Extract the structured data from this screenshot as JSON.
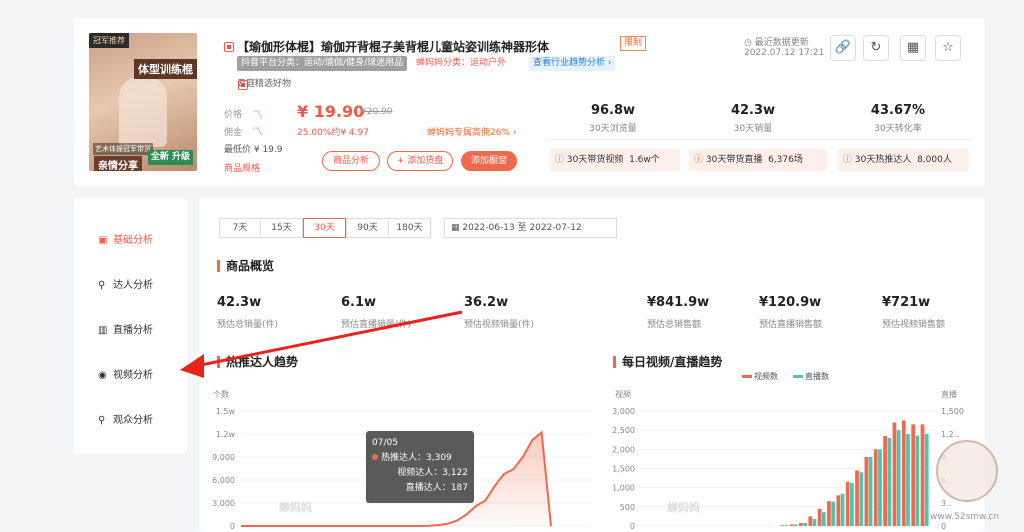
{
  "product": {
    "image": {
      "badge": "冠军推荐",
      "title": "体型训练棍",
      "sub1": "艺术体操冠军带货",
      "sub2": "亲情分享",
      "sub3": "全新 升级"
    },
    "title": "【瑜伽形体棍】瑜伽开背棍子美背棍儿童站姿训练神器形体",
    "limit_tag": "限制",
    "platform_category": "抖音平台分类：运动/瑜伽/健身/球迷用品",
    "chanmama_category": "蝉妈妈分类：运动户外",
    "trend_link": "查看行业趋势分析 ›",
    "shop": "云庭精选好物",
    "price_label": "价格",
    "price": "¥ 19.90",
    "price_old": "¥20.90",
    "commission_label": "佣金",
    "commission": "25.00%约¥ 4.97",
    "commission_link": "蝉妈妈专属高佣26% ›",
    "lowest_price": "最低价 ¥ 19.9",
    "spec_link": "商品规格",
    "btn_analysis": "商品分析",
    "btn_addgoods": "+ 添加货盘",
    "btn_window": "添加橱窗",
    "update_label": "最近数据更新",
    "update_time": "2022.07.12 17:21"
  },
  "kpis": [
    {
      "value": "96.8w",
      "label": "30天浏览量"
    },
    {
      "value": "42.3w",
      "label": "30天销量"
    },
    {
      "value": "43.67%",
      "label": "30天转化率"
    }
  ],
  "kpi_chips": [
    {
      "label": "30天带货视频",
      "value": "1.6w个"
    },
    {
      "label": "30天带货直播",
      "value": "6,376场"
    },
    {
      "label": "30天热推达人",
      "value": "8,000人"
    }
  ],
  "nav": [
    {
      "label": "基础分析",
      "icon": "chart-icon"
    },
    {
      "label": "达人分析",
      "icon": "user-icon"
    },
    {
      "label": "直播分析",
      "icon": "live-icon"
    },
    {
      "label": "视频分析",
      "icon": "play-icon"
    },
    {
      "label": "观众分析",
      "icon": "audience-icon"
    }
  ],
  "range_tabs": [
    "7天",
    "15天",
    "30天",
    "90天",
    "180天"
  ],
  "date_range": "2022-06-13  至  2022-07-12",
  "overview": {
    "title": "商品概览",
    "items": [
      {
        "value": "42.3w",
        "label": "预估总销量(件)"
      },
      {
        "value": "6.1w",
        "label": "预估直播销量(件)"
      },
      {
        "value": "36.2w",
        "label": "预估视频销量(件)"
      },
      {
        "value": "¥841.9w",
        "label": "预估总销售额"
      },
      {
        "value": "¥120.9w",
        "label": "预估直播销售额"
      },
      {
        "value": "¥721w",
        "label": "预估视频销售额"
      }
    ]
  },
  "talent_chart": {
    "title": "热推达人趋势",
    "y_caption": "个数",
    "y_ticks": [
      "1.5w",
      "1.2w",
      "9,000",
      "6,000",
      "3,000",
      "0"
    ],
    "watermark": "蝉妈妈",
    "tooltip": {
      "date": "07/05",
      "hot_label": "热推达人：",
      "hot": "3,309",
      "video_label": "视频达人：",
      "video": "3,122",
      "live_label": "直播达人：",
      "live": "187"
    }
  },
  "daily_chart": {
    "title": "每日视频/直播趋势",
    "legend_video": "视频数",
    "legend_live": "直播数",
    "left_caption": "视频",
    "right_caption": "直播",
    "left_ticks": [
      "3,000",
      "2,500",
      "2,000",
      "1,500",
      "1,000",
      "500",
      "0"
    ],
    "right_ticks": [
      "1,500",
      "1,2..",
      "9..",
      "6..",
      "3..",
      "0"
    ],
    "watermark": "蝉妈妈"
  },
  "site_watermark": "www.52smw.cn",
  "colors": {
    "accent": "#ef6a4c",
    "video": "#ef6a4c",
    "live": "#4fc3b0"
  },
  "chart_data": [
    {
      "type": "area",
      "title": "热推达人趋势",
      "ylabel": "个数",
      "ylim": [
        0,
        15000
      ],
      "series": [
        {
          "name": "热推达人",
          "values": [
            0,
            0,
            0,
            0,
            0,
            0,
            0,
            0,
            0,
            0,
            0,
            0,
            0,
            0,
            0,
            0,
            0,
            0,
            0,
            0,
            40,
            120,
            300,
            700,
            1500,
            2600,
            3309,
            5200,
            6800,
            7400,
            9000,
            11200,
            12200,
            0
          ]
        }
      ]
    },
    {
      "type": "bar",
      "title": "每日视频/直播趋势",
      "series": [
        {
          "name": "视频数",
          "values": [
            0,
            0,
            0,
            0,
            0,
            0,
            0,
            0,
            0,
            0,
            0,
            0,
            0,
            0,
            0,
            20,
            40,
            80,
            250,
            450,
            650,
            800,
            1150,
            1450,
            1800,
            2000,
            2350,
            2700,
            2750,
            2650,
            2650
          ]
        },
        {
          "name": "直播数",
          "values": [
            0,
            0,
            0,
            0,
            0,
            0,
            0,
            0,
            0,
            0,
            0,
            0,
            0,
            0,
            0,
            10,
            20,
            40,
            90,
            180,
            320,
            420,
            560,
            700,
            900,
            1000,
            1150,
            1250,
            1200,
            1180,
            1200
          ]
        }
      ],
      "ylim_left": [
        0,
        3000
      ],
      "ylim_right": [
        0,
        1500
      ]
    }
  ]
}
